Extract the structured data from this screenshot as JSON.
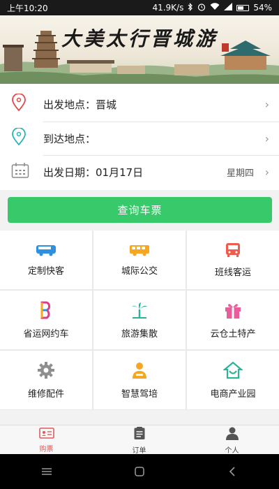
{
  "status_bar": {
    "time": "上午10:20",
    "speed": "41.9K/s",
    "battery": "54%",
    "icons": [
      "bluetooth-icon",
      "alarm-icon",
      "wifi-icon",
      "battery-icon"
    ]
  },
  "banner": {
    "title": "大美太行晋城游"
  },
  "form": {
    "departure_label": "出发地点：晋城",
    "arrival_label": "到达地点：",
    "date_label": "出发日期：01月17日",
    "weekday": "星期四"
  },
  "search_button": "查询车票",
  "services": [
    {
      "label": "定制快客",
      "icon": "bus-blue-icon"
    },
    {
      "label": "城际公交",
      "icon": "bus-yellow-icon"
    },
    {
      "label": "班线客运",
      "icon": "bus-red-icon"
    },
    {
      "label": "省运网约车",
      "icon": "ride-hailing-icon"
    },
    {
      "label": "旅游集散",
      "icon": "palm-tree-icon"
    },
    {
      "label": "云仓土特产",
      "icon": "gift-icon"
    },
    {
      "label": "维修配件",
      "icon": "gear-icon"
    },
    {
      "label": "智慧驾培",
      "icon": "driver-training-icon"
    },
    {
      "label": "电商产业园",
      "icon": "ecommerce-park-icon"
    }
  ],
  "tabs": [
    {
      "label": "购票",
      "icon": "ticket-icon",
      "active": true
    },
    {
      "label": "订单",
      "icon": "clipboard-icon",
      "active": false
    },
    {
      "label": "个人",
      "icon": "person-icon",
      "active": false
    }
  ],
  "colors": {
    "accent_green": "#37c96a",
    "active_tab_red": "#e25a5a"
  }
}
